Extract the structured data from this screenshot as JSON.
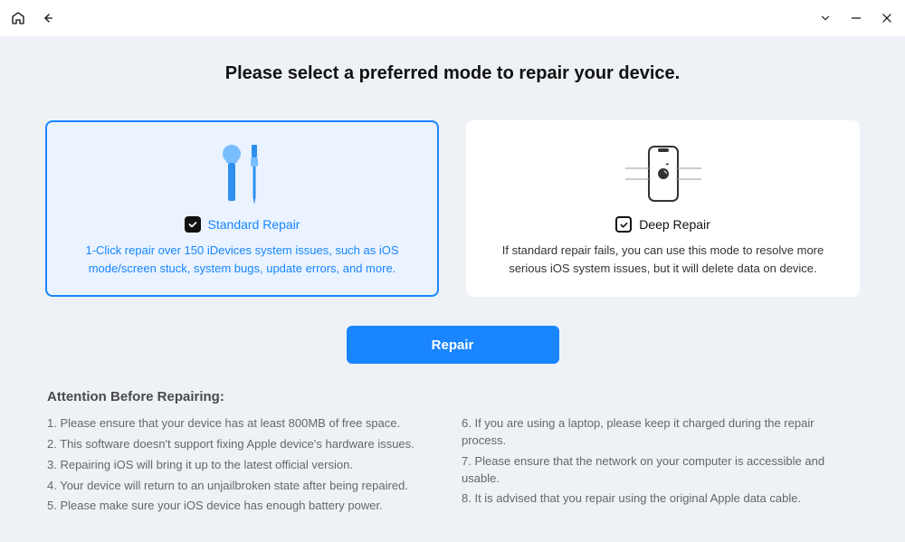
{
  "header": {
    "title": "Please select a preferred mode to repair your device."
  },
  "modes": {
    "standard": {
      "title": "Standard Repair",
      "description": "1-Click repair over 150 iDevices system issues, such as iOS mode/screen stuck, system bugs, update errors, and more.",
      "selected": true
    },
    "deep": {
      "title": "Deep Repair",
      "description": "If standard repair fails, you can use this mode to resolve more serious iOS system issues, but it will delete data on device.",
      "selected": false
    }
  },
  "actions": {
    "repair": "Repair"
  },
  "attention": {
    "title": "Attention Before Repairing:",
    "left": {
      "i1": "1. Please ensure that your device has at least 800MB of free space.",
      "i2": "2. This software doesn't support fixing Apple device's hardware issues.",
      "i3": "3. Repairing iOS will bring it up to the latest official version.",
      "i4": "4. Your device will return to an unjailbroken state after being repaired.",
      "i5": "5. Please make sure your iOS device has enough battery power."
    },
    "right": {
      "i6": "6. If you are using a laptop, please keep it charged during the repair process.",
      "i7": "7. Please ensure that the network on your computer is accessible and usable.",
      "i8": "8. It is advised that you repair using the original Apple data cable."
    }
  },
  "colors": {
    "accent": "#1985ff",
    "bg": "#eef2f7"
  }
}
